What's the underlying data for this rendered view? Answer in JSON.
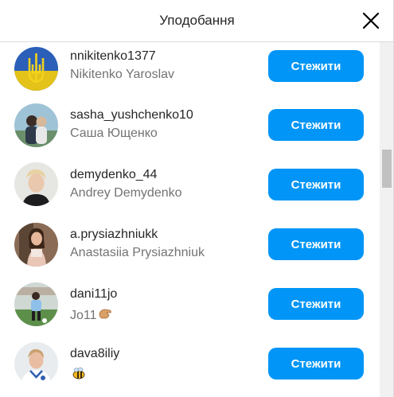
{
  "dialog": {
    "title": "Уподобання",
    "close_icon": "close-icon"
  },
  "likes": [
    {
      "username": "nnikitenko1377",
      "full_name": "Nikitenko Yaroslav",
      "button": "Стежити"
    },
    {
      "username": "sasha_yushchenko10",
      "full_name": "Саша Ющенко",
      "button": "Стежити"
    },
    {
      "username": "demydenko_44",
      "full_name": "Andrey Demydenko",
      "button": "Стежити"
    },
    {
      "username": "a.prysiazhniukk",
      "full_name": "Anastasiia Prysiazhniuk",
      "button": "Стежити"
    },
    {
      "username": "dani11jo",
      "full_name": "Jo11",
      "full_name_emoji": "hand-emoji-icon",
      "button": "Стежити"
    },
    {
      "username": "dava8iliy",
      "full_name": "",
      "full_name_emoji": "bee-emoji-icon",
      "button": "Стежити"
    }
  ],
  "colors": {
    "button_blue": "#0095f6",
    "text_primary": "#262626",
    "text_secondary": "#737373",
    "divider": "#dbdbdb"
  }
}
